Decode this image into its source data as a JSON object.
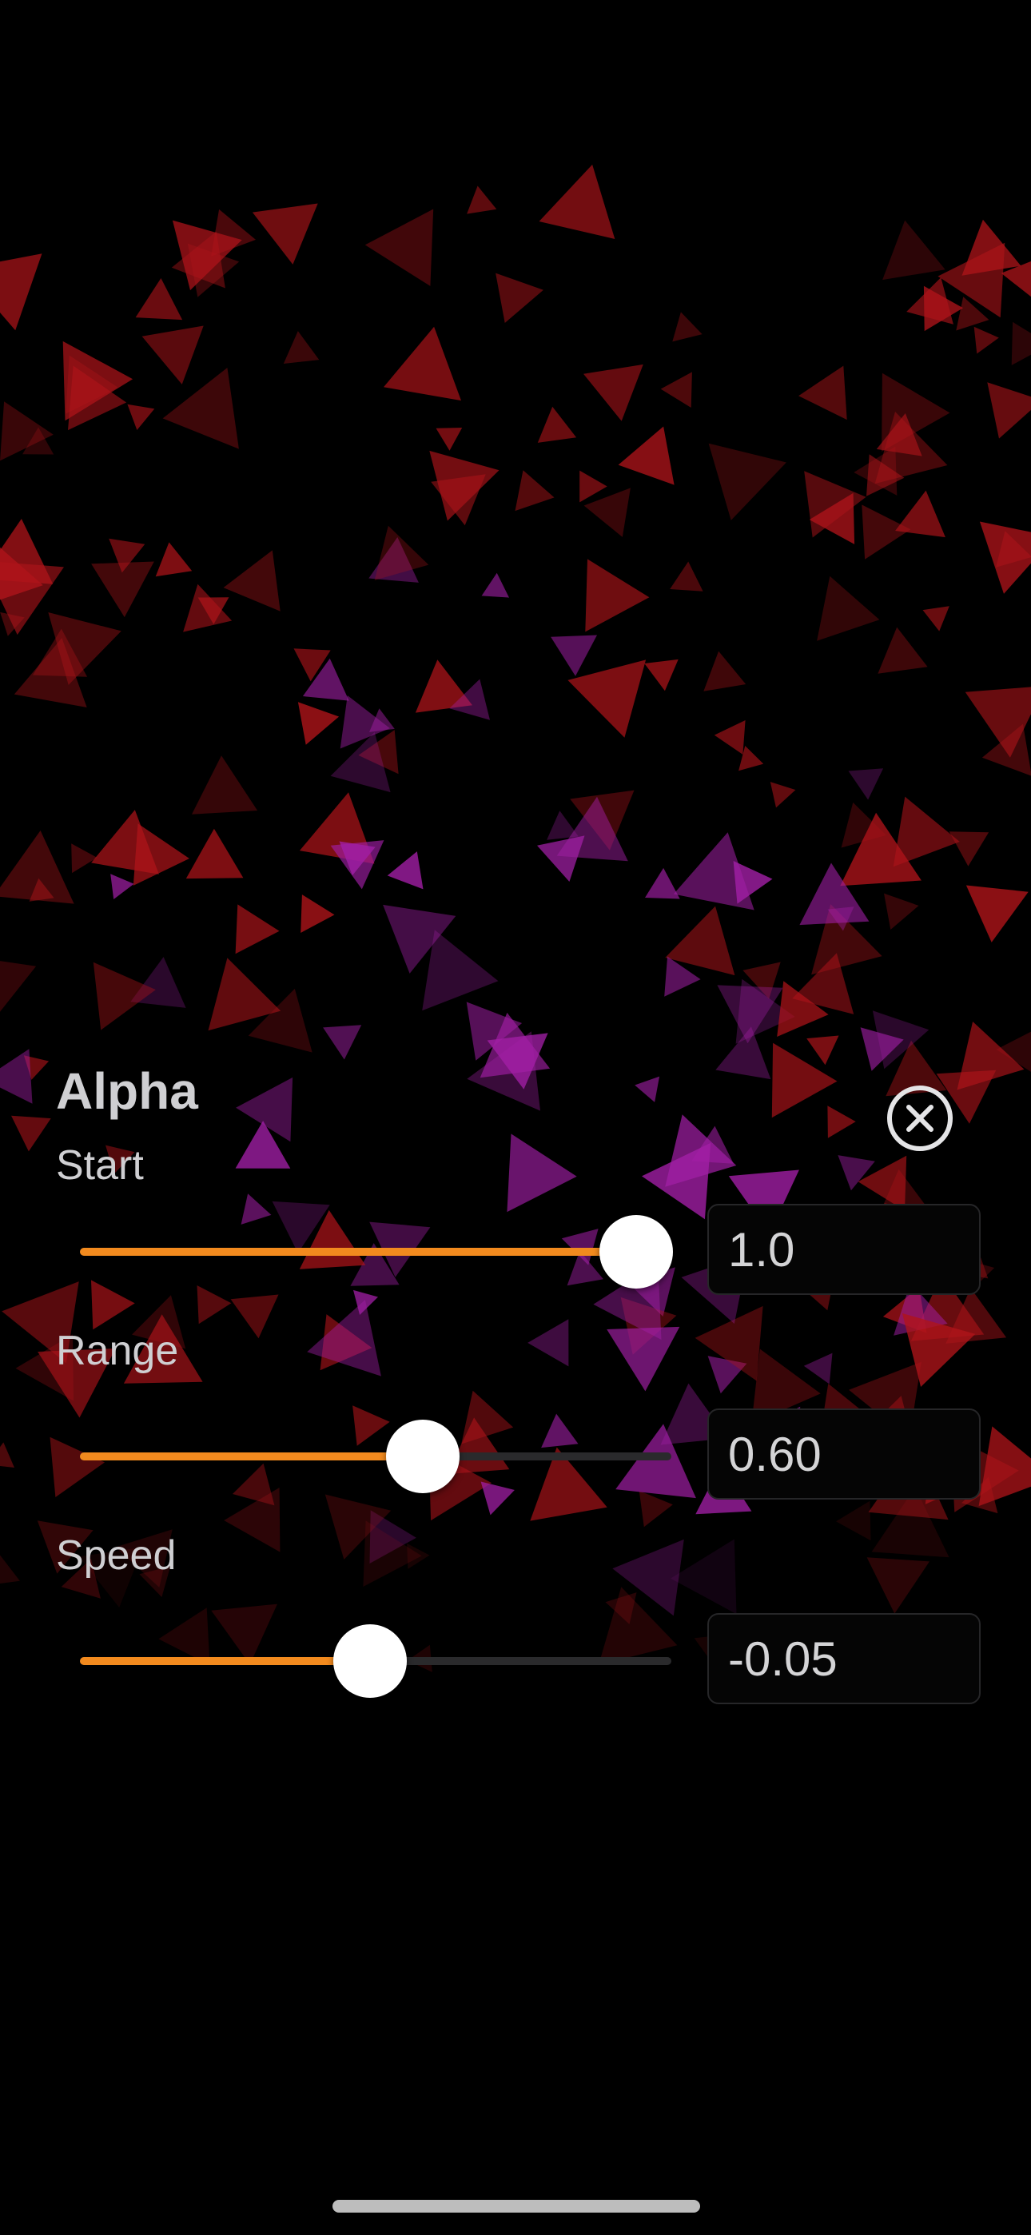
{
  "panel": {
    "title": "Alpha",
    "close_icon": "close-circle-icon"
  },
  "params": [
    {
      "label": "Start",
      "value_text": "1.0",
      "slider_fraction": 0.94
    },
    {
      "label": "Range",
      "value_text": "0.60",
      "slider_fraction": 0.58
    },
    {
      "label": "Speed",
      "value_text": "-0.05",
      "slider_fraction": 0.49
    }
  ],
  "colors": {
    "accent": "#f28a1e",
    "track": "#2a2a2c",
    "thumb": "#ffffff",
    "text": "#cfcfd2",
    "particle_red": "#b0141a",
    "particle_purple": "#a21fa6"
  }
}
